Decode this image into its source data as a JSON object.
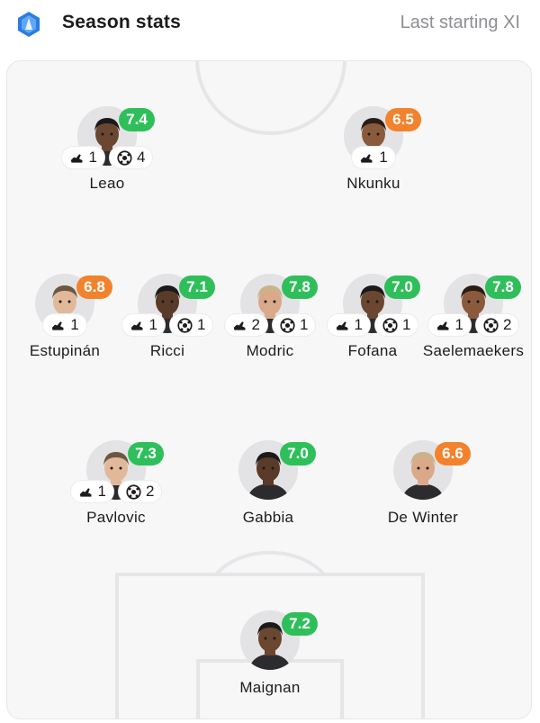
{
  "header": {
    "title": "Season stats",
    "subtab": "Last starting XI",
    "logo_icon": "serie-a-logo-icon"
  },
  "colors": {
    "rating_green": "#2fbf5a",
    "rating_orange": "#f2822b",
    "pitch": "#f7f7f8"
  },
  "lineup": {
    "forwards": [
      {
        "name": "Leao",
        "rating": "7.4",
        "rating_color": "green",
        "assists": "1",
        "goals": "4"
      },
      {
        "name": "Nkunku",
        "rating": "6.5",
        "rating_color": "orange",
        "assists": "1",
        "goals": null
      }
    ],
    "midfielders": [
      {
        "name": "Estupinán",
        "rating": "6.8",
        "rating_color": "orange",
        "assists": "1",
        "goals": null
      },
      {
        "name": "Ricci",
        "rating": "7.1",
        "rating_color": "green",
        "assists": "1",
        "goals": "1"
      },
      {
        "name": "Modric",
        "rating": "7.8",
        "rating_color": "green",
        "assists": "2",
        "goals": "1"
      },
      {
        "name": "Fofana",
        "rating": "7.0",
        "rating_color": "green",
        "assists": "1",
        "goals": "1"
      },
      {
        "name": "Saelemaekers",
        "rating": "7.8",
        "rating_color": "green",
        "assists": "1",
        "goals": "2"
      }
    ],
    "defenders": [
      {
        "name": "Pavlovic",
        "rating": "7.3",
        "rating_color": "green",
        "assists": "1",
        "goals": "2"
      },
      {
        "name": "Gabbia",
        "rating": "7.0",
        "rating_color": "green",
        "assists": null,
        "goals": null
      },
      {
        "name": "De Winter",
        "rating": "6.6",
        "rating_color": "orange",
        "assists": null,
        "goals": null
      }
    ],
    "goalkeeper": [
      {
        "name": "Maignan",
        "rating": "7.2",
        "rating_color": "green",
        "assists": null,
        "goals": null
      }
    ]
  }
}
